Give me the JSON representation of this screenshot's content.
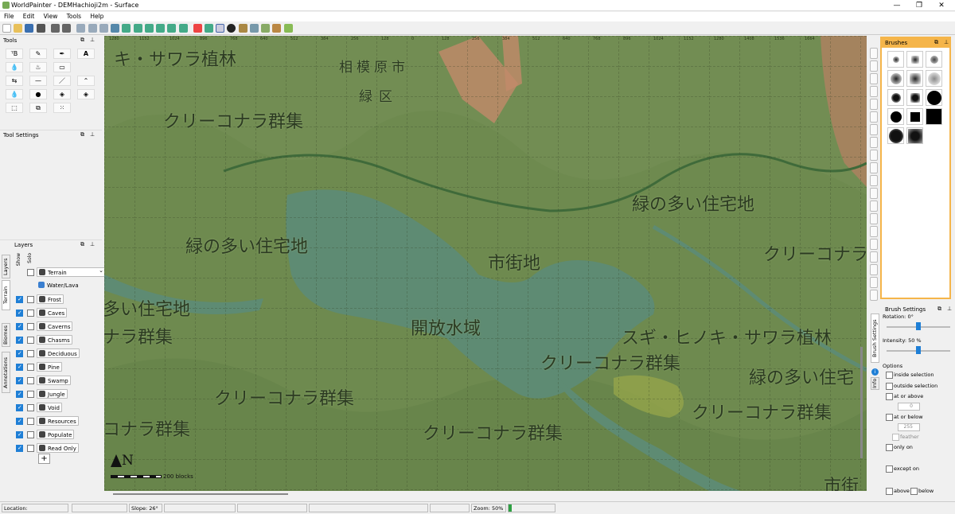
{
  "window": {
    "title": "WorldPainter - DEMHachioji2m - Surface",
    "minimize": "—",
    "maximize": "❐",
    "close": "✕"
  },
  "menu": [
    "File",
    "Edit",
    "View",
    "Tools",
    "Help"
  ],
  "tools_panel": {
    "title": "Tools"
  },
  "tool_settings": {
    "title": "Tool Settings"
  },
  "layers_panel": {
    "title": "Layers",
    "col_show": "Show",
    "col_solo": "Solo",
    "tabs": [
      "Layers",
      "Terrain",
      "Biomes",
      "Annotations"
    ],
    "items": [
      {
        "label": "Terrain",
        "show": false,
        "solo": false,
        "dropdown": true
      },
      {
        "label": "Water/Lava",
        "show": false,
        "solo": false
      },
      {
        "label": "Frost",
        "show": true,
        "solo": false
      },
      {
        "label": "Caves",
        "show": true,
        "solo": false
      },
      {
        "label": "Caverns",
        "show": true,
        "solo": false
      },
      {
        "label": "Chasms",
        "show": true,
        "solo": false
      },
      {
        "label": "Deciduous",
        "show": true,
        "solo": false
      },
      {
        "label": "Pine",
        "show": true,
        "solo": false
      },
      {
        "label": "Swamp",
        "show": true,
        "solo": false
      },
      {
        "label": "Jungle",
        "show": true,
        "solo": false
      },
      {
        "label": "Void",
        "show": true,
        "solo": false
      },
      {
        "label": "Resources",
        "show": true,
        "solo": false
      },
      {
        "label": "Populate",
        "show": true,
        "solo": false
      },
      {
        "label": "Read Only",
        "show": true,
        "solo": false
      }
    ],
    "add_button": "+"
  },
  "map": {
    "labels": [
      {
        "text": "キ・サワラ植林"
      },
      {
        "text": "相模原市"
      },
      {
        "text": "緑区"
      },
      {
        "text": "クリーコナラ群集"
      },
      {
        "text": "緑の多い住宅地"
      },
      {
        "text": "緑の多い住宅地"
      },
      {
        "text": "市街地"
      },
      {
        "text": "クリーコナラ"
      },
      {
        "text": "多い住宅地"
      },
      {
        "text": "開放水域"
      },
      {
        "text": "ナラ群集"
      },
      {
        "text": "スギ・ヒノキ・サワラ植林"
      },
      {
        "text": "クリーコナラ群集"
      },
      {
        "text": "緑の多い住宅"
      },
      {
        "text": "クリーコナラ群集"
      },
      {
        "text": "クリーコナラ群集"
      },
      {
        "text": "コナラ群集"
      },
      {
        "text": "クリーコナラ群集"
      },
      {
        "text": "市街"
      }
    ],
    "ruler": [
      "1280",
      "1152",
      "1024",
      "896",
      "768",
      "640",
      "512",
      "384",
      "256",
      "128",
      "0",
      "128",
      "256",
      "384",
      "512",
      "640",
      "768",
      "896",
      "1024",
      "1152",
      "1280",
      "1408",
      "1536",
      "1664"
    ],
    "scale_label": "200 blocks",
    "compass": "N",
    "colors": {
      "terrain": "#6e8a4f",
      "water": "#5e8b73",
      "peaks": "#c28a6a"
    }
  },
  "brushes_panel": {
    "title": "Brushes"
  },
  "brush_settings": {
    "title": "Brush Settings",
    "rotation": "Rotation: 0°",
    "intensity": "Intensity: 50 %",
    "rotation_value": 0.5,
    "intensity_value": 0.5,
    "tabs": [
      "Brush Settings",
      "Info"
    ],
    "options_title": "Options",
    "options": [
      "inside selection",
      "outside selection",
      "at or above",
      "at or below",
      "only on",
      "except on",
      "above",
      "below"
    ],
    "at_or_above_value": "0",
    "at_or_below_value": "255",
    "feather": "feather"
  },
  "status": {
    "location": "Location:",
    "slope": "Slope: 26°",
    "zoom": "Zoom: 50%"
  }
}
